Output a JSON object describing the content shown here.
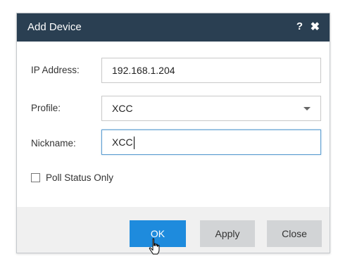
{
  "dialog": {
    "title": "Add Device",
    "help_icon": "question-icon",
    "close_icon": "close-icon"
  },
  "form": {
    "ip_address": {
      "label": "IP Address:",
      "value": "192.168.1.204"
    },
    "profile": {
      "label": "Profile:",
      "value": "XCC"
    },
    "nickname": {
      "label": "Nickname:",
      "value": "XCC"
    },
    "poll_status_only": {
      "label": "Poll Status Only",
      "checked": false
    }
  },
  "buttons": {
    "ok": "OK",
    "apply": "Apply",
    "close": "Close"
  },
  "colors": {
    "titlebar": "#2a3f52",
    "primary_button": "#1e8bdd",
    "secondary_button": "#d2d4d6",
    "focus_border": "#5f9fd1"
  }
}
